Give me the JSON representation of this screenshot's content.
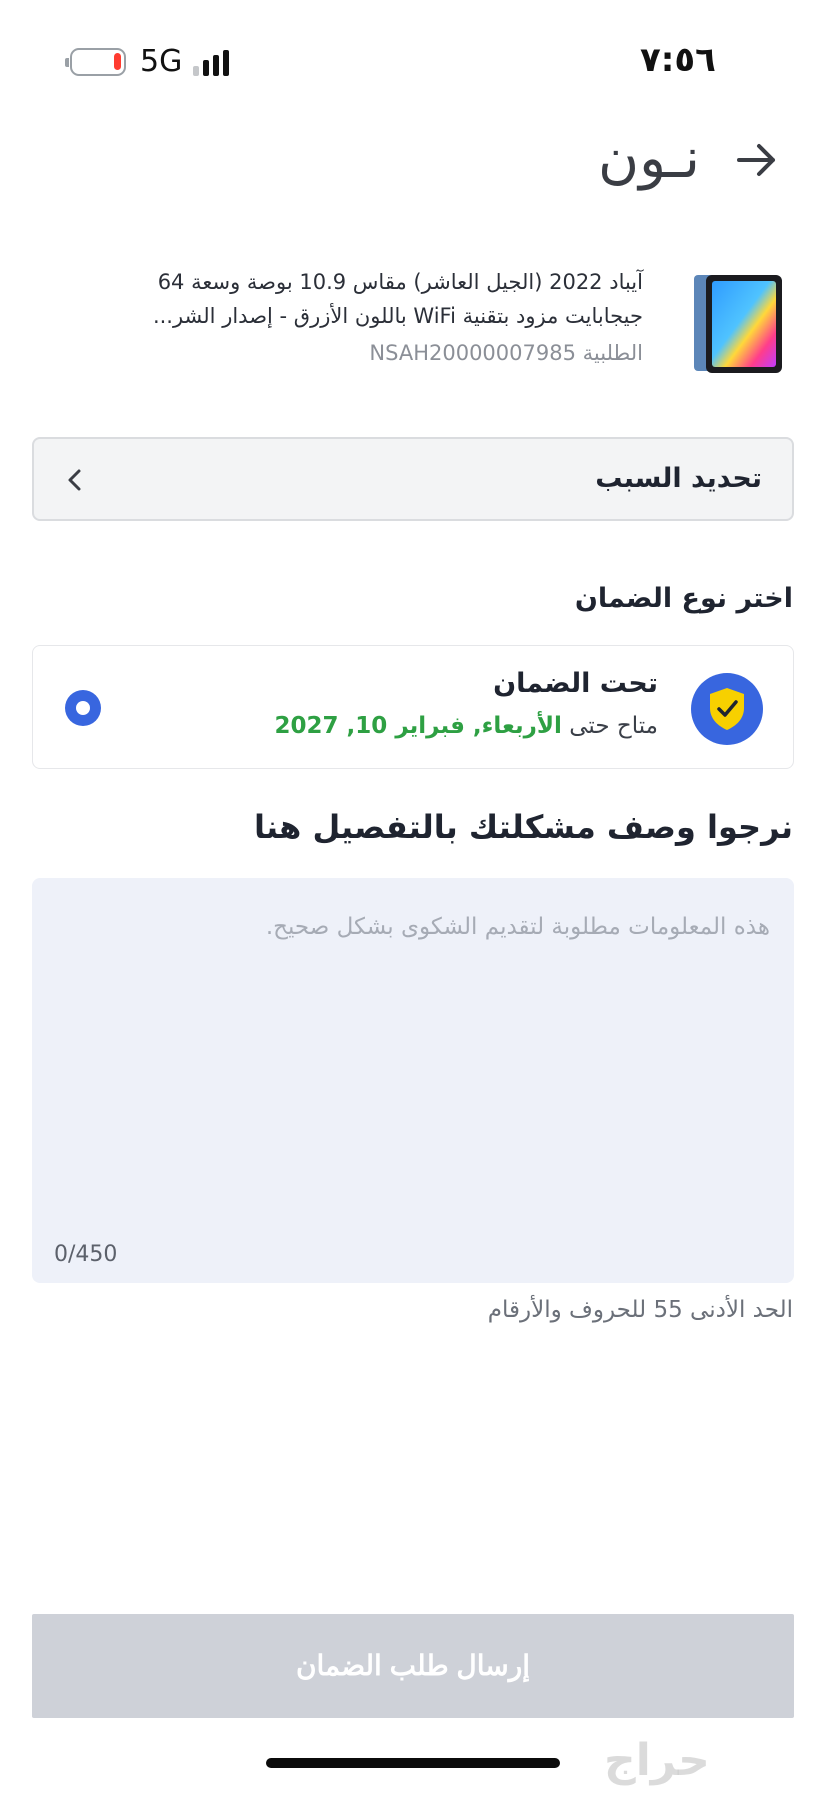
{
  "status_bar": {
    "network": "5G",
    "time": "٧:٥٦",
    "battery_level": 0.15
  },
  "header": {
    "logo": "نـون",
    "back_icon": "arrow-right-icon"
  },
  "product": {
    "title": "آيباد 2022 (الجيل العاشر) مقاس 10.9 بوصة وسعة 64 جيجابايت مزود بتقنية WiFi باللون الأزرق - إصدار الشر...",
    "order_label": "الطلبية NSAH20000007985"
  },
  "reason_select": {
    "label": "تحديد السبب",
    "icon": "chevron-left-icon"
  },
  "warranty": {
    "section_title": "اختر نوع الضمان",
    "option_title": "تحت الضمان",
    "available_until": "متاح حتى",
    "date": "الأربعاء, فبراير 10, 2027",
    "selected": true,
    "icon": "shield-check-icon"
  },
  "description": {
    "section_title": "نرجوا وصف مشكلتك بالتفصيل هنا",
    "placeholder": "هذه المعلومات مطلوبة لتقديم الشكوى بشكل صحيح.",
    "counter": "0/450",
    "min_hint": "الحد الأدنى 55 للحروف والأرقام"
  },
  "submit": {
    "label": "إرسال طلب الضمان",
    "enabled": false
  },
  "watermark": "حراج",
  "colors": {
    "accent_blue": "#3866df",
    "success_green": "#2ea043",
    "disabled_button": "#ced1d8",
    "textarea_bg": "#eef1f9",
    "shield_yellow": "#f7d000"
  }
}
